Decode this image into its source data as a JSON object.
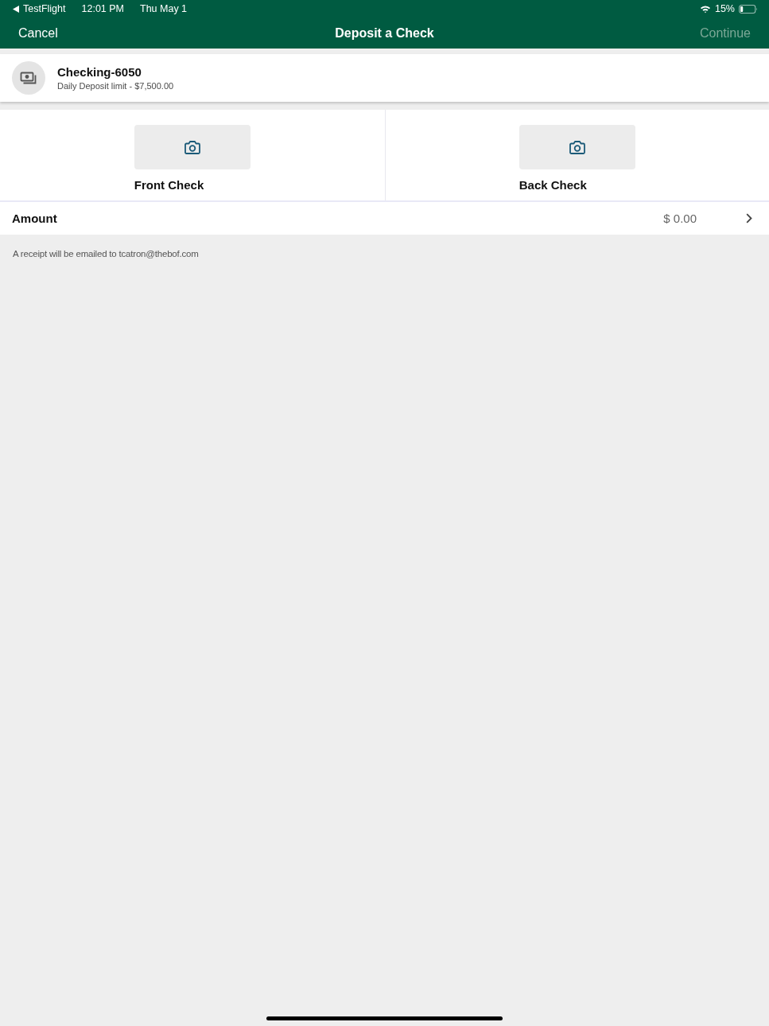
{
  "status_bar": {
    "back_app": "TestFlight",
    "time": "12:01 PM",
    "date": "Thu May 1",
    "battery": "15%"
  },
  "nav_bar": {
    "cancel": "Cancel",
    "title": "Deposit a Check",
    "continue": {
      "label": "Continue",
      "disabled": true
    }
  },
  "account": {
    "name": "Checking-6050",
    "limit": "Daily Deposit limit - $7,500.00"
  },
  "captures": [
    {
      "label": "Front Check"
    },
    {
      "label": "Back Check"
    }
  ],
  "amount": {
    "label": "Amount",
    "value": "$ 0.00"
  },
  "receipt_note": "A receipt will be emailed to tcatron@thebof.com"
}
